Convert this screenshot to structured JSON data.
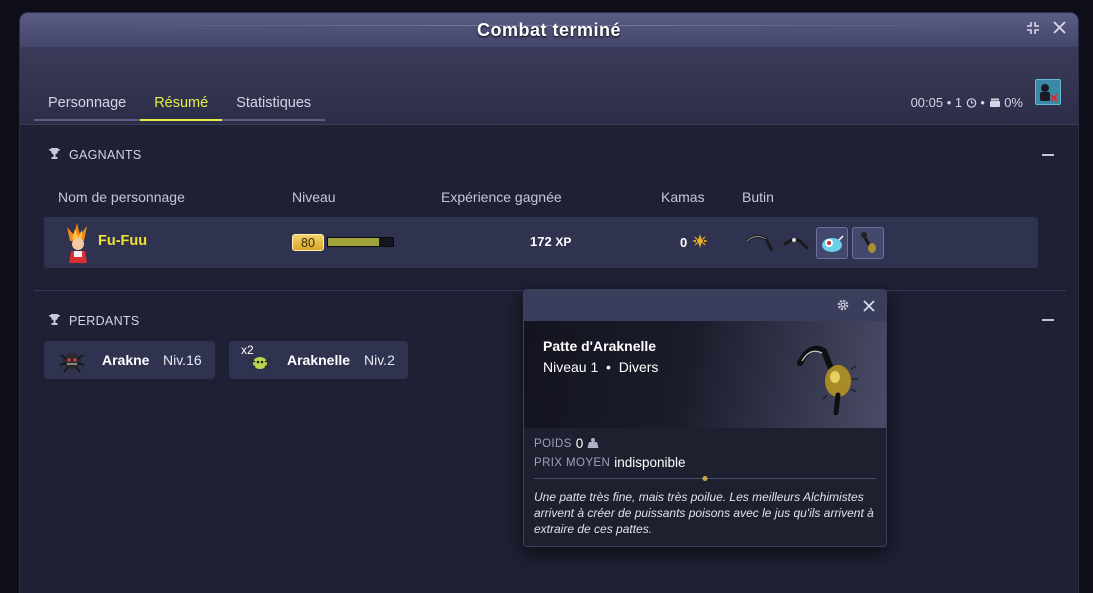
{
  "window": {
    "title": "Combat terminé"
  },
  "tabs": [
    {
      "label": "Personnage"
    },
    {
      "label": "Résumé"
    },
    {
      "label": "Statistiques"
    }
  ],
  "fight_info": {
    "duration": "00:05",
    "turns": "1",
    "challenge": "0%"
  },
  "winners": {
    "title": "GAGNANTS",
    "columns": {
      "name": "Nom de personnage",
      "level": "Niveau",
      "xp": "Expérience gagnée",
      "kamas": "Kamas",
      "loot": "Butin"
    },
    "rows": [
      {
        "name": "Fu-Fuu",
        "level": "80",
        "xp_progress": 0.78,
        "xp": "172",
        "xp_unit": "XP",
        "kamas": "0",
        "loot": [
          "patte-item-1",
          "patte-item-2",
          "blue-creature-item",
          "dark-figure-item"
        ]
      }
    ]
  },
  "losers": {
    "title": "PERDANTS",
    "items": [
      {
        "name": "Arakne",
        "level": "Niv.16",
        "count": ""
      },
      {
        "name": "Araknelle",
        "level": "Niv.2",
        "count": "x2"
      }
    ]
  },
  "tooltip": {
    "name": "Patte d'Araknelle",
    "level": "Niveau 1",
    "type": "Divers",
    "weight_label": "POIDS",
    "weight": "0",
    "price_label": "PRIX MOYEN",
    "price": "indisponible",
    "description": "Une patte très fine, mais très poilue. Les meilleurs Alchimistes arrivent à créer de puissants poisons avec le jus qu'ils arrivent à extraire de ces pattes."
  },
  "colors": {
    "accent": "#e6f04a",
    "name_yellow": "#f0e030",
    "background": "#1e2033",
    "row": "#2f3350"
  }
}
